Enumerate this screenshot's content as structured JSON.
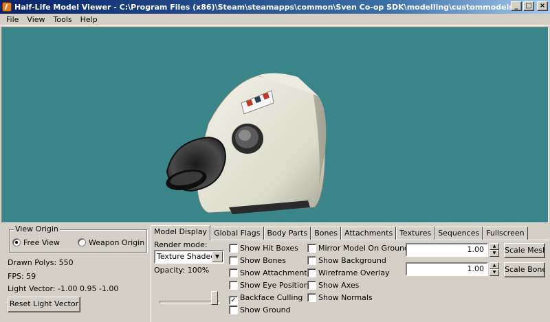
{
  "window": {
    "title": "Half-Life Model Viewer - C:\\Program Files (x86)\\Steam\\steamapps\\common\\Sven Co-op SDK\\modelling\\custommodels\\hand...",
    "minimize": "_",
    "maximize": "□",
    "close": "×"
  },
  "menu": {
    "file": "File",
    "view": "View",
    "tools": "Tools",
    "help": "Help"
  },
  "viewport": {
    "background": "#398589"
  },
  "left_panel": {
    "view_origin": {
      "title": "View Origin",
      "free_view": "Free View",
      "weapon_origin": "Weapon Origin",
      "selected": "free_view"
    },
    "drawn_polys": "Drawn Polys: 550",
    "fps": "FPS: 59",
    "light_vector": "Light Vector: -1.00 0.95 -1.00",
    "reset_light": "Reset Light Vector"
  },
  "tabs": [
    "Model Display",
    "Global Flags",
    "Body Parts",
    "Bones",
    "Attachments",
    "Textures",
    "Sequences",
    "Fullscreen"
  ],
  "model_display": {
    "render_mode_label": "Render mode:",
    "render_mode_value": "Texture Shaded",
    "opacity_label": "Opacity: 100%",
    "opacity_value": 1.0,
    "checks_col1": {
      "show_hit_boxes": "Show Hit Boxes",
      "show_bones": "Show Bones",
      "show_attachments": "Show Attachments",
      "show_eye_position": "Show Eye Position",
      "backface_culling": "Backface Culling",
      "show_ground": "Show Ground"
    },
    "checks_col2": {
      "mirror_model": "Mirror Model On Ground",
      "show_background": "Show Background",
      "wireframe_overlay": "Wireframe Overlay",
      "show_axes": "Show Axes",
      "show_normals": "Show Normals"
    },
    "checked_mark": "✓",
    "scale_mesh_value": "1.00",
    "scale_bones_value": "1.00",
    "scale_mesh_button": "Scale Mesh",
    "scale_bones_button": "Scale Bones",
    "spin_up": "▲",
    "spin_down": "▼"
  }
}
